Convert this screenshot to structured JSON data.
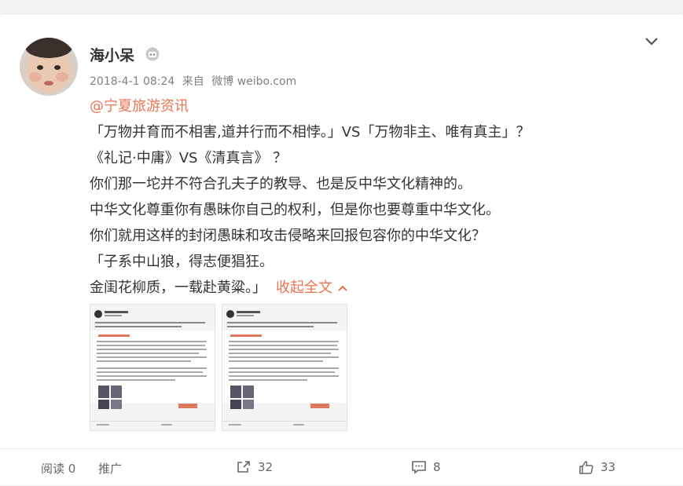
{
  "post": {
    "author": "海小呆",
    "date": "2018-4-1 08:24",
    "source_prefix": "来自",
    "source": "微博 weibo.com",
    "mention": "@宁夏旅游资讯",
    "lines": [
      "「万物并育而不相害,道并行而不相悖。」VS「万物非主、唯有真主」？",
      "《礼记·中庸》VS《清真言》 ？",
      "你们那一坨并不符合孔夫子的教导、也是反中华文化精神的。",
      "中华文化尊重你有愚昧你自己的权利，但是你也要尊重中华文化。",
      "你们就用这样的封闭愚昧和攻击侵略来回报包容你的中华文化？",
      "「子系中山狼，得志便猖狂。"
    ],
    "last_line": "金闺花柳质，一载赴黄粱。」",
    "collapse_label": "收起全文",
    "images": [
      {
        "icon": "screenshot-image"
      },
      {
        "icon": "screenshot-image"
      }
    ]
  },
  "footer": {
    "read_label": "阅读",
    "read_count": "0",
    "promote_label": "推广",
    "repost_count": "32",
    "comment_count": "8",
    "like_count": "33"
  },
  "colors": {
    "accent": "#eb7350",
    "text": "#333333",
    "meta": "#808080"
  }
}
